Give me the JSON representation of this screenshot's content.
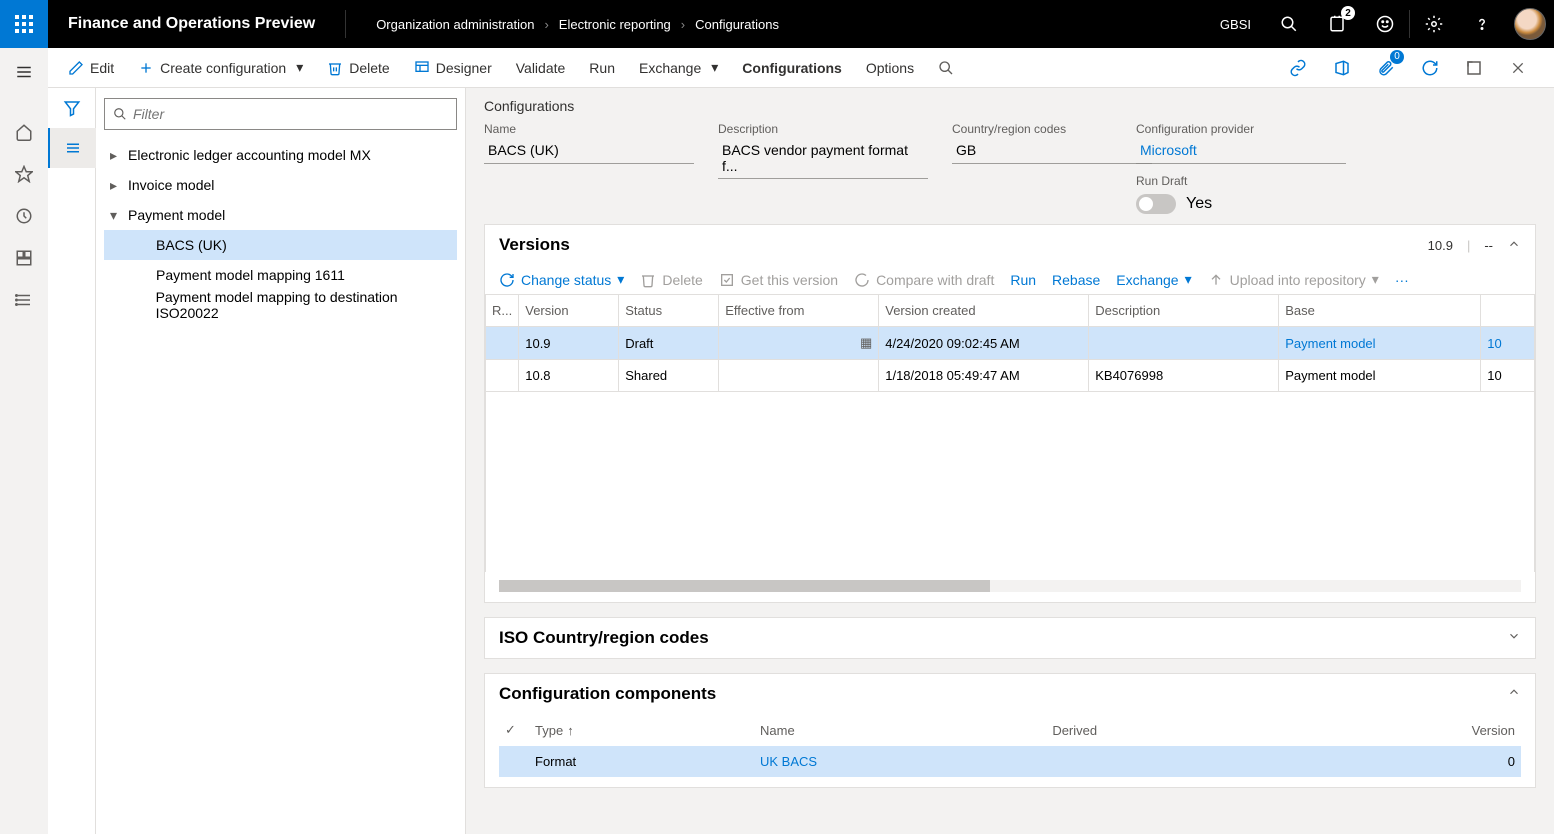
{
  "header": {
    "app_title": "Finance and Operations Preview",
    "breadcrumb": [
      "Organization administration",
      "Electronic reporting",
      "Configurations"
    ],
    "company": "GBSI",
    "notification_count": "2"
  },
  "toolbar": {
    "edit": "Edit",
    "create": "Create configuration",
    "delete": "Delete",
    "designer": "Designer",
    "validate": "Validate",
    "run": "Run",
    "exchange": "Exchange",
    "configurations": "Configurations",
    "options": "Options",
    "badge0": "0"
  },
  "tree": {
    "filter_placeholder": "Filter",
    "items": [
      {
        "label": "Electronic ledger accounting model MX",
        "expand": "right",
        "level": 1
      },
      {
        "label": "Invoice model",
        "expand": "right",
        "level": 1
      },
      {
        "label": "Payment model",
        "expand": "down",
        "level": 1
      },
      {
        "label": "BACS (UK)",
        "expand": "",
        "level": 2,
        "selected": true
      },
      {
        "label": "Payment model mapping 1611",
        "expand": "",
        "level": 2
      },
      {
        "label": "Payment model mapping to destination ISO20022",
        "expand": "",
        "level": 2
      }
    ]
  },
  "details": {
    "section": "Configurations",
    "name_label": "Name",
    "name_value": "BACS (UK)",
    "desc_label": "Description",
    "desc_value": "BACS vendor payment format f...",
    "country_label": "Country/region codes",
    "country_value": "GB",
    "provider_label": "Configuration provider",
    "provider_value": "Microsoft",
    "run_draft_label": "Run Draft",
    "run_draft_value": "Yes"
  },
  "versions": {
    "title": "Versions",
    "meta_version": "10.9",
    "meta_dash": "--",
    "toolbar": {
      "change_status": "Change status",
      "delete": "Delete",
      "get": "Get this version",
      "compare": "Compare with draft",
      "run": "Run",
      "rebase": "Rebase",
      "exchange": "Exchange",
      "upload": "Upload into repository"
    },
    "columns": [
      "R...",
      "Version",
      "Status",
      "Effective from",
      "Version created",
      "Description",
      "Base",
      ""
    ],
    "rows": [
      {
        "version": "10.9",
        "status": "Draft",
        "effective": "",
        "has_cal": true,
        "created": "4/24/2020 09:02:45 AM",
        "description": "",
        "base": "Payment model",
        "base_num": "10",
        "selected": true,
        "link": true
      },
      {
        "version": "10.8",
        "status": "Shared",
        "effective": "",
        "has_cal": false,
        "created": "1/18/2018 05:49:47 AM",
        "description": "KB4076998",
        "base": "Payment model",
        "base_num": "10",
        "selected": false,
        "link": false
      }
    ]
  },
  "iso_section": {
    "title": "ISO Country/region codes"
  },
  "components": {
    "title": "Configuration components",
    "columns": {
      "type": "Type",
      "name": "Name",
      "derived": "Derived",
      "version": "Version"
    },
    "rows": [
      {
        "type": "Format",
        "name": "UK BACS",
        "derived": "",
        "version": "0"
      }
    ]
  }
}
